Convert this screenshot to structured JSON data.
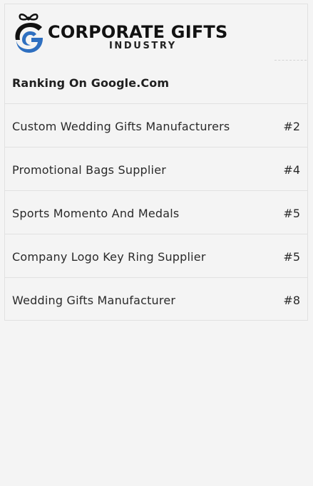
{
  "brand": {
    "title": "CORPORATE GIFTS",
    "subtitle": "INDUSTRY",
    "icon": "gift-bow-g-logo-icon",
    "colors": {
      "accent_blue": "#2e6fc0",
      "dark": "#111111"
    }
  },
  "ranking": {
    "heading": "Ranking On Google.Com",
    "items": [
      {
        "label": "Custom Wedding Gifts Manufacturers",
        "rank": "#2"
      },
      {
        "label": "Promotional Bags Supplier",
        "rank": "#4"
      },
      {
        "label": "Sports Momento And Medals",
        "rank": "#5"
      },
      {
        "label": "Company Logo Key Ring Supplier",
        "rank": "#5"
      },
      {
        "label": "Wedding Gifts Manufacturer",
        "rank": "#8"
      }
    ]
  }
}
